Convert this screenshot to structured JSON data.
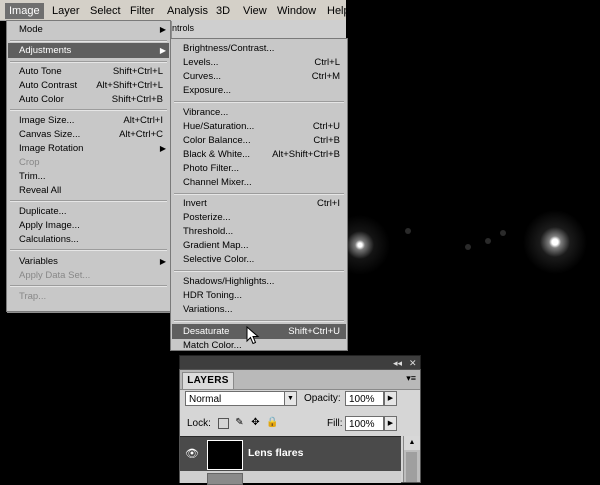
{
  "menubar": {
    "items": [
      {
        "label": "Image"
      },
      {
        "label": "Layer"
      },
      {
        "label": "Select"
      },
      {
        "label": "Filter"
      },
      {
        "label": "Analysis"
      },
      {
        "label": "3D"
      },
      {
        "label": "View"
      },
      {
        "label": "Window"
      },
      {
        "label": "Help"
      }
    ]
  },
  "strip_text": "ntrols",
  "image_menu": {
    "items": [
      {
        "label": "Mode",
        "shortcut": "",
        "submenu": true
      },
      {
        "label": "Adjustments",
        "shortcut": "",
        "submenu": true,
        "highlighted": true
      },
      {
        "label": "Auto Tone",
        "shortcut": "Shift+Ctrl+L"
      },
      {
        "label": "Auto Contrast",
        "shortcut": "Alt+Shift+Ctrl+L"
      },
      {
        "label": "Auto Color",
        "shortcut": "Shift+Ctrl+B"
      },
      {
        "label": "Image Size...",
        "shortcut": "Alt+Ctrl+I"
      },
      {
        "label": "Canvas Size...",
        "shortcut": "Alt+Ctrl+C"
      },
      {
        "label": "Image Rotation",
        "shortcut": "",
        "submenu": true
      },
      {
        "label": "Crop",
        "shortcut": "",
        "disabled": true
      },
      {
        "label": "Trim...",
        "shortcut": ""
      },
      {
        "label": "Reveal All",
        "shortcut": ""
      },
      {
        "label": "Duplicate...",
        "shortcut": ""
      },
      {
        "label": "Apply Image...",
        "shortcut": ""
      },
      {
        "label": "Calculations...",
        "shortcut": ""
      },
      {
        "label": "Variables",
        "shortcut": "",
        "submenu": true
      },
      {
        "label": "Apply Data Set...",
        "shortcut": "",
        "disabled": true
      },
      {
        "label": "Trap...",
        "shortcut": "",
        "disabled": true
      }
    ]
  },
  "adjustments_menu": {
    "items": [
      {
        "label": "Brightness/Contrast...",
        "shortcut": ""
      },
      {
        "label": "Levels...",
        "shortcut": "Ctrl+L"
      },
      {
        "label": "Curves...",
        "shortcut": "Ctrl+M"
      },
      {
        "label": "Exposure...",
        "shortcut": ""
      },
      {
        "label": "Vibrance...",
        "shortcut": ""
      },
      {
        "label": "Hue/Saturation...",
        "shortcut": "Ctrl+U"
      },
      {
        "label": "Color Balance...",
        "shortcut": "Ctrl+B"
      },
      {
        "label": "Black & White...",
        "shortcut": "Alt+Shift+Ctrl+B"
      },
      {
        "label": "Photo Filter...",
        "shortcut": ""
      },
      {
        "label": "Channel Mixer...",
        "shortcut": ""
      },
      {
        "label": "Invert",
        "shortcut": "Ctrl+I"
      },
      {
        "label": "Posterize...",
        "shortcut": ""
      },
      {
        "label": "Threshold...",
        "shortcut": ""
      },
      {
        "label": "Gradient Map...",
        "shortcut": ""
      },
      {
        "label": "Selective Color...",
        "shortcut": ""
      },
      {
        "label": "Shadows/Highlights...",
        "shortcut": ""
      },
      {
        "label": "HDR Toning...",
        "shortcut": ""
      },
      {
        "label": "Variations...",
        "shortcut": ""
      },
      {
        "label": "Desaturate",
        "shortcut": "Shift+Ctrl+U",
        "highlighted": true
      },
      {
        "label": "Match Color...",
        "shortcut": ""
      }
    ]
  },
  "layers_panel": {
    "tab_label": "LAYERS",
    "blend_mode": "Normal",
    "opacity_label": "Opacity:",
    "opacity_value": "100%",
    "lock_label": "Lock:",
    "fill_label": "Fill:",
    "fill_value": "100%",
    "layer_name": "Lens flares"
  },
  "colors": {
    "menu_bg": "#c8c8c8",
    "highlight": "#5f5f5f",
    "layer_selected": "#4a4a4a"
  }
}
